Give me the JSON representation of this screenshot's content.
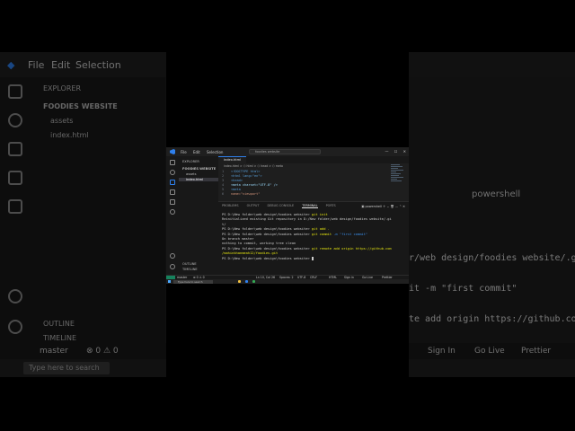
{
  "app": {
    "menu": [
      "File",
      "Edit",
      "Selection"
    ],
    "command_center": "foodies website",
    "accent": "#2f80ed"
  },
  "explorer": {
    "header": "EXPLORER",
    "folder": "FOODIES WEBSITE",
    "items": [
      "assets",
      "index.html"
    ],
    "outline": "OUTLINE",
    "timeline": "TIMELINE"
  },
  "editor": {
    "tab": "index.html",
    "breadcrumb": "index.html > ⬡ html > ⬡ head > ⬡ meta",
    "lines": [
      {
        "n": "1",
        "t": "<!DOCTYPE html>"
      },
      {
        "n": "2",
        "t": "<html lang=\"en\">"
      },
      {
        "n": "3",
        "t": "  <head>"
      },
      {
        "n": "4",
        "t": "    <meta charset=\"UTF-8\" />"
      },
      {
        "n": "5",
        "t": "    <meta"
      },
      {
        "n": "6",
        "t": "      name=\"viewport\""
      }
    ]
  },
  "panel": {
    "tabs": [
      "PROBLEMS",
      "OUTPUT",
      "DEBUG CONSOLE",
      "TERMINAL",
      "PORTS"
    ],
    "active_tab": "TERMINAL",
    "shell": "powershell",
    "terminal_lines": [
      {
        "prompt": "PS D:\\New folder\\web design\\foodies website> ",
        "cmd": "git init",
        "rest": ""
      },
      {
        "prompt": "Reinitialized existing Git repository in D:/New folder/web design/foodies website/.gi",
        "cmd": "",
        "rest": ""
      },
      {
        "prompt": "t/",
        "cmd": "",
        "rest": ""
      },
      {
        "prompt": "PS D:\\New folder\\web design\\foodies website> ",
        "cmd": "git add .",
        "rest": ""
      },
      {
        "prompt": "PS D:\\New folder\\web design\\foodies website> ",
        "cmd": "git commit",
        "rest": " -m \"first commit\""
      },
      {
        "prompt": "On branch master",
        "cmd": "",
        "rest": ""
      },
      {
        "prompt": "nothing to commit, working tree clean",
        "cmd": "",
        "rest": ""
      },
      {
        "prompt": "PS D:\\New folder\\web design\\foodies website> ",
        "cmd": "git remote add origin https://github.com",
        "rest": ""
      },
      {
        "prompt": "/mahinkhanmeah12/foodies.git",
        "cmd": "",
        "rest": ""
      },
      {
        "prompt": "PS D:\\New folder\\web design\\foodies website> ",
        "cmd": "",
        "rest": ""
      }
    ]
  },
  "statusbar": {
    "branch": "master",
    "errors": "⊗ 0 ⚠ 0",
    "position": "Ln 10, Col 26",
    "spaces": "Spaces: 2",
    "encoding": "UTF-8",
    "eol": "CRLF",
    "language": "HTML",
    "signin": "Sign in",
    "golive": "Go Live",
    "prettier": "Prettier"
  },
  "taskbar": {
    "search_placeholder": "Type here to search"
  },
  "background": {
    "menu": [
      "File",
      "Edit",
      "Selection"
    ],
    "explorer": "EXPLORER",
    "folder": "FOODIES WEBSITE",
    "items": [
      "assets",
      "index.html"
    ],
    "outline": "OUTLINE",
    "timeline": "TIMELINE",
    "shell": "powershell",
    "right_lines": [
      "r/web design/foodies website/.gi",
      "it -m \"first commit\"",
      "te add origin https://github.com"
    ],
    "status": [
      "master",
      "⊗ 0 ⚠ 0",
      "Sign In",
      "Go Live",
      "Prettier"
    ],
    "taskbar_search": "Type here to search",
    "term_fragments": [
      "PS",
      "Rei",
      "t/",
      "PS",
      "PS",
      "On",
      "no",
      "PS",
      "/ma",
      "PS"
    ]
  }
}
